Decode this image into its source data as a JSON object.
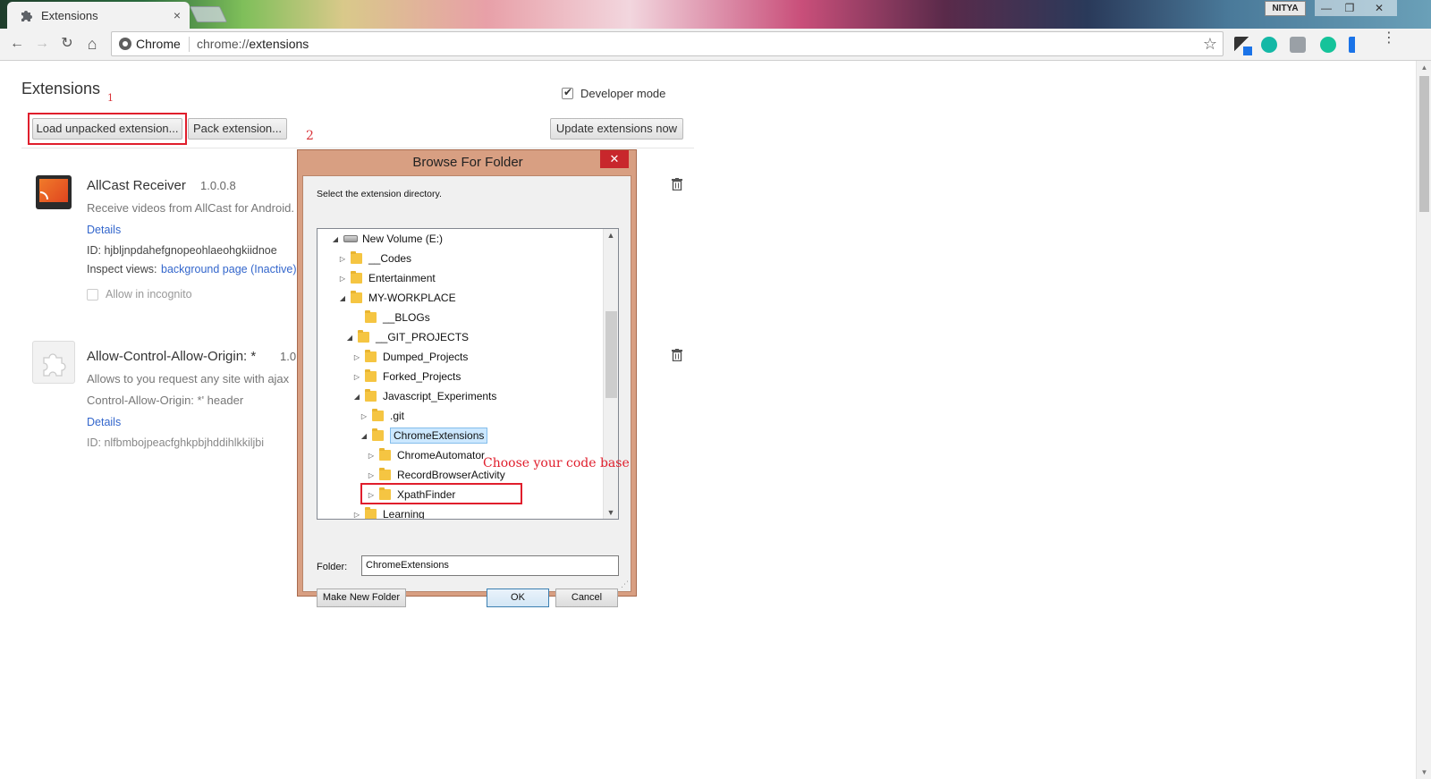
{
  "browser": {
    "tab_title": "Extensions",
    "tab_close": "×",
    "user_badge": "NITYA",
    "window_buttons": {
      "minimize": "—",
      "restore": "❐",
      "close": "✕"
    },
    "nav": {
      "back": "←",
      "forward": "→",
      "reload": "↻",
      "home": "⌂"
    },
    "omnibox": {
      "scheme_label": "Chrome",
      "url_prefix": "chrome://",
      "url_path": "extensions"
    },
    "star": "☆"
  },
  "page": {
    "title": "Extensions",
    "annotation_1": "1",
    "annotation_2": "2",
    "developer_mode_label": "Developer mode",
    "developer_mode_checked": true,
    "buttons": {
      "load_unpacked": "Load unpacked extension...",
      "pack": "Pack extension...",
      "update": "Update extensions now"
    },
    "extensions": [
      {
        "name": "AllCast Receiver",
        "version": "1.0.0.8",
        "description": "Receive videos from AllCast for Android.",
        "details_label": "Details",
        "id_label": "ID: hjbljnpdahefgnopeohlaeohgkiidnoe",
        "inspect_label": "Inspect views:",
        "inspect_link": "background page (Inactive)",
        "incognito_label": "Allow in incognito"
      },
      {
        "name": "Allow-Control-Allow-Origin: *",
        "version": "1.0",
        "description_line1": "Allows to you request any site with ajax",
        "description_line2": "Control-Allow-Origin: *' header",
        "details_label": "Details",
        "id_label": "ID: nlfbmbojpeacfghkpbjhddihlkkiljbi"
      }
    ]
  },
  "dialog": {
    "title": "Browse For Folder",
    "close_label": "✕",
    "description": "Select the extension directory.",
    "tree": [
      {
        "label": "New Volume (E:)",
        "arrow": "◢",
        "kind": "drive"
      },
      {
        "label": "__Codes",
        "arrow": "▷"
      },
      {
        "label": "Entertainment",
        "arrow": "▷"
      },
      {
        "label": "MY-WORKPLACE",
        "arrow": "◢"
      },
      {
        "label": "__BLOGs",
        "arrow": ""
      },
      {
        "label": "__GIT_PROJECTS",
        "arrow": "◢"
      },
      {
        "label": "Dumped_Projects",
        "arrow": "▷"
      },
      {
        "label": "Forked_Projects",
        "arrow": "▷"
      },
      {
        "label": "Javascript_Experiments",
        "arrow": "◢"
      },
      {
        "label": ".git",
        "arrow": "▷"
      },
      {
        "label": "ChromeExtensions",
        "arrow": "◢",
        "selected": true
      },
      {
        "label": "ChromeAutomator",
        "arrow": "▷"
      },
      {
        "label": "RecordBrowserActivity",
        "arrow": "▷"
      },
      {
        "label": "XpathFinder",
        "arrow": "▷"
      },
      {
        "label": "Learning",
        "arrow": "▷"
      }
    ],
    "annotation_choose": "Choose your code base",
    "folder_label": "Folder:",
    "folder_value": "ChromeExtensions",
    "make_new_folder": "Make New Folder",
    "ok": "OK",
    "cancel": "Cancel"
  },
  "colors": {
    "link": "#3366cc",
    "annotation_red": "#e01e2c",
    "dialog_frame": "#d89f82",
    "close_red": "#c8272c"
  }
}
